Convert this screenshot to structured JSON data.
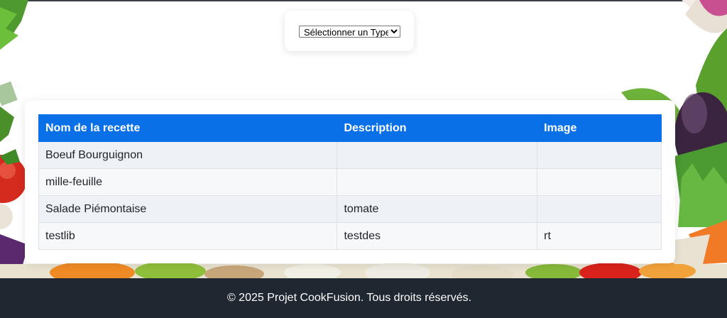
{
  "filter": {
    "select_label": "Sélectionner un Type"
  },
  "table": {
    "headers": [
      "Nom de la recette",
      "Description",
      "Image"
    ],
    "rows": [
      [
        "Boeuf Bourguignon",
        "",
        ""
      ],
      [
        "mille-feuille",
        "",
        ""
      ],
      [
        "Salade Piémontaise",
        "tomate",
        ""
      ],
      [
        "testlib",
        "testdes",
        "rt"
      ]
    ]
  },
  "footer": {
    "text": "© 2025 Projet CookFusion. Tous droits réservés."
  },
  "colors": {
    "header_blue": "#0a70e8",
    "footer_bg": "#1f2731"
  }
}
